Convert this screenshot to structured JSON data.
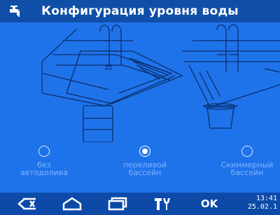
{
  "header": {
    "title": "Конфигурация уровня воды",
    "icon": "faucet-icon"
  },
  "options": [
    {
      "line1": "без",
      "line2": "автодолива",
      "selected": false
    },
    {
      "line1": "переливой",
      "line2": "бассейн",
      "selected": true
    },
    {
      "line1": "Скиммерный",
      "line2": "бассейн",
      "selected": false
    }
  ],
  "footer": {
    "back_icon": "back-delete-icon",
    "home_icon": "home-icon",
    "windows_icon": "windows-icon",
    "tools_icon": "tools-icon",
    "ok_label": "OK",
    "time": "13:41",
    "date": "25.02.1"
  },
  "colors": {
    "background": "#1f73ea",
    "header": "#104fa8",
    "footer": "#0d4aa8",
    "line": "#0a2f6e",
    "text_dim": "#7fb3ff"
  }
}
